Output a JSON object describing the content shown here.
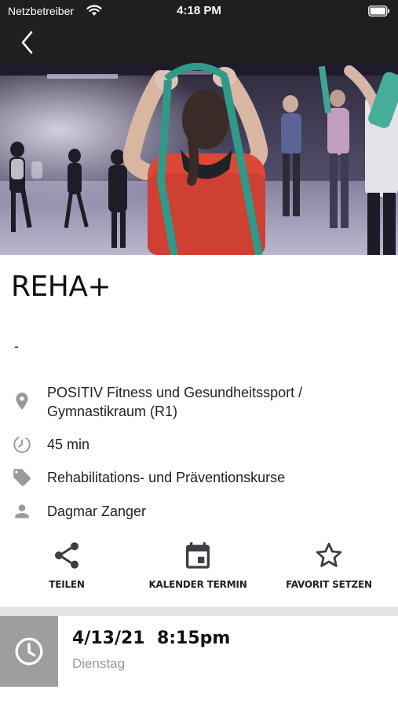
{
  "status_bar": {
    "carrier": "Netzbetreiber",
    "time": "4:18 PM"
  },
  "course": {
    "title": "REHA+",
    "subtitle": "-",
    "location": "POSITIV Fitness und Gesundheitssport / Gymnastikraum (R1)",
    "duration": "45 min",
    "category": "Rehabilitations- und Präventionskurse",
    "trainer": "Dagmar Zanger"
  },
  "actions": {
    "share_label": "TEILEN",
    "calendar_label": "KALENDER TERMIN",
    "favorite_label": "FAVORIT SETZEN"
  },
  "date_card": {
    "date": "4/13/21",
    "time": "8:15pm",
    "weekday": "Dienstag"
  },
  "colors": {
    "dark_bar": "#1f1f1f",
    "icon_gray": "#9e9e9e",
    "action_icon": "#3a3f44",
    "divider": "#e4e4e4"
  },
  "icons": [
    "wifi-icon",
    "battery-icon",
    "back-chevron-icon",
    "location-pin-icon",
    "timer-icon",
    "tag-icon",
    "person-icon",
    "share-icon",
    "calendar-icon",
    "star-outline-icon",
    "clock-icon"
  ]
}
